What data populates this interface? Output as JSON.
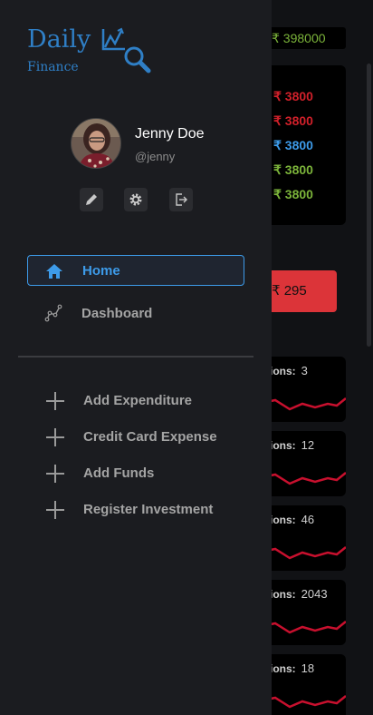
{
  "colors": {
    "accent": "#3d9be9",
    "drawer_bg": "#1b1c20",
    "danger": "#dc3439",
    "positive": "#7bb33a",
    "negative": "#d0202a",
    "info": "#3d9be9"
  },
  "logo": {
    "title": "Daily",
    "subtitle": "Finance"
  },
  "user": {
    "name": "Jenny Doe",
    "handle": "@jenny"
  },
  "profile_actions": [
    {
      "name": "edit",
      "icon": "pencil-icon"
    },
    {
      "name": "settings",
      "icon": "gear-icon"
    },
    {
      "name": "logout",
      "icon": "logout-icon"
    }
  ],
  "nav": [
    {
      "label": "Home",
      "icon": "home-icon",
      "active": true
    },
    {
      "label": "Dashboard",
      "icon": "chart-line-icon",
      "active": false
    }
  ],
  "actions": [
    {
      "label": "Add Expenditure",
      "icon": "plus-icon"
    },
    {
      "label": "Credit Card Expense",
      "icon": "plus-icon"
    },
    {
      "label": "Add Funds",
      "icon": "plus-icon"
    },
    {
      "label": "Register Investment",
      "icon": "plus-icon"
    }
  ],
  "background": {
    "balance": "₹ 398000",
    "amounts": [
      {
        "text": "₹ 3800",
        "color": "#d0202a"
      },
      {
        "text": "₹ 3800",
        "color": "#d0202a"
      },
      {
        "text": "₹ 3800",
        "color": "#3d9be9"
      },
      {
        "text": "₹ 3800",
        "color": "#7bb33a"
      },
      {
        "text": "₹ 3800",
        "color": "#7bb33a"
      }
    ],
    "red_button": "₹ 295",
    "transaction_cards": [
      {
        "label": "ions:",
        "count": "3"
      },
      {
        "label": "ions:",
        "count": "12"
      },
      {
        "label": "ions:",
        "count": "46"
      },
      {
        "label": "ions:",
        "count": "2043"
      },
      {
        "label": "ions:",
        "count": "18"
      }
    ]
  }
}
